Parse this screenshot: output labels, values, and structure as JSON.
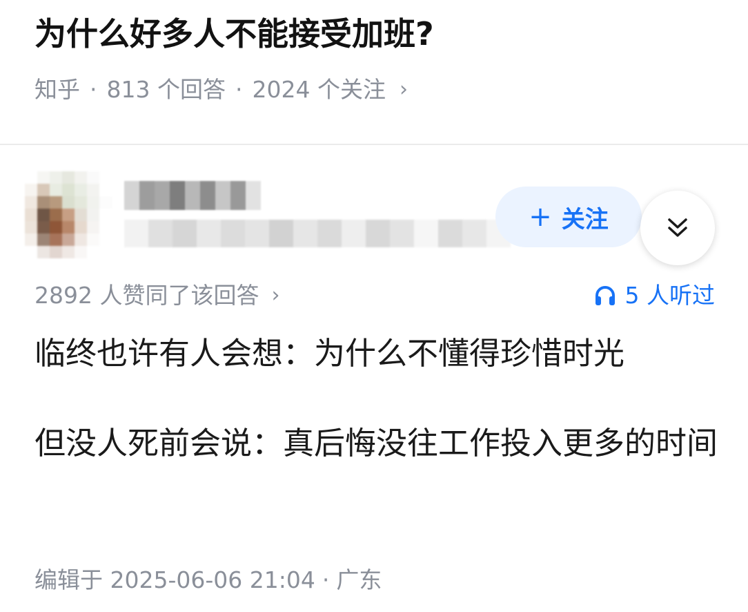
{
  "question": {
    "title": "为什么好多人不能接受加班?",
    "source": "知乎",
    "answers": "813 个回答",
    "followers": "2024 个关注"
  },
  "author": {
    "follow_label": "关注"
  },
  "answer": {
    "voteup": "2892 人赞同了该回答",
    "listened": "5 人听过",
    "paragraphs": [
      "临终也许有人会想：为什么不懂得珍惜时光",
      "但没人死前会说：真后悔没往工作投入更多的时间"
    ],
    "edited_prefix": "编辑于",
    "edited_time": "2025-06-06 21:04",
    "location": "广东"
  },
  "colors": {
    "accent": "#1772f6",
    "follow_bg": "#ebf3ff",
    "meta_gray": "#8a8f99"
  }
}
